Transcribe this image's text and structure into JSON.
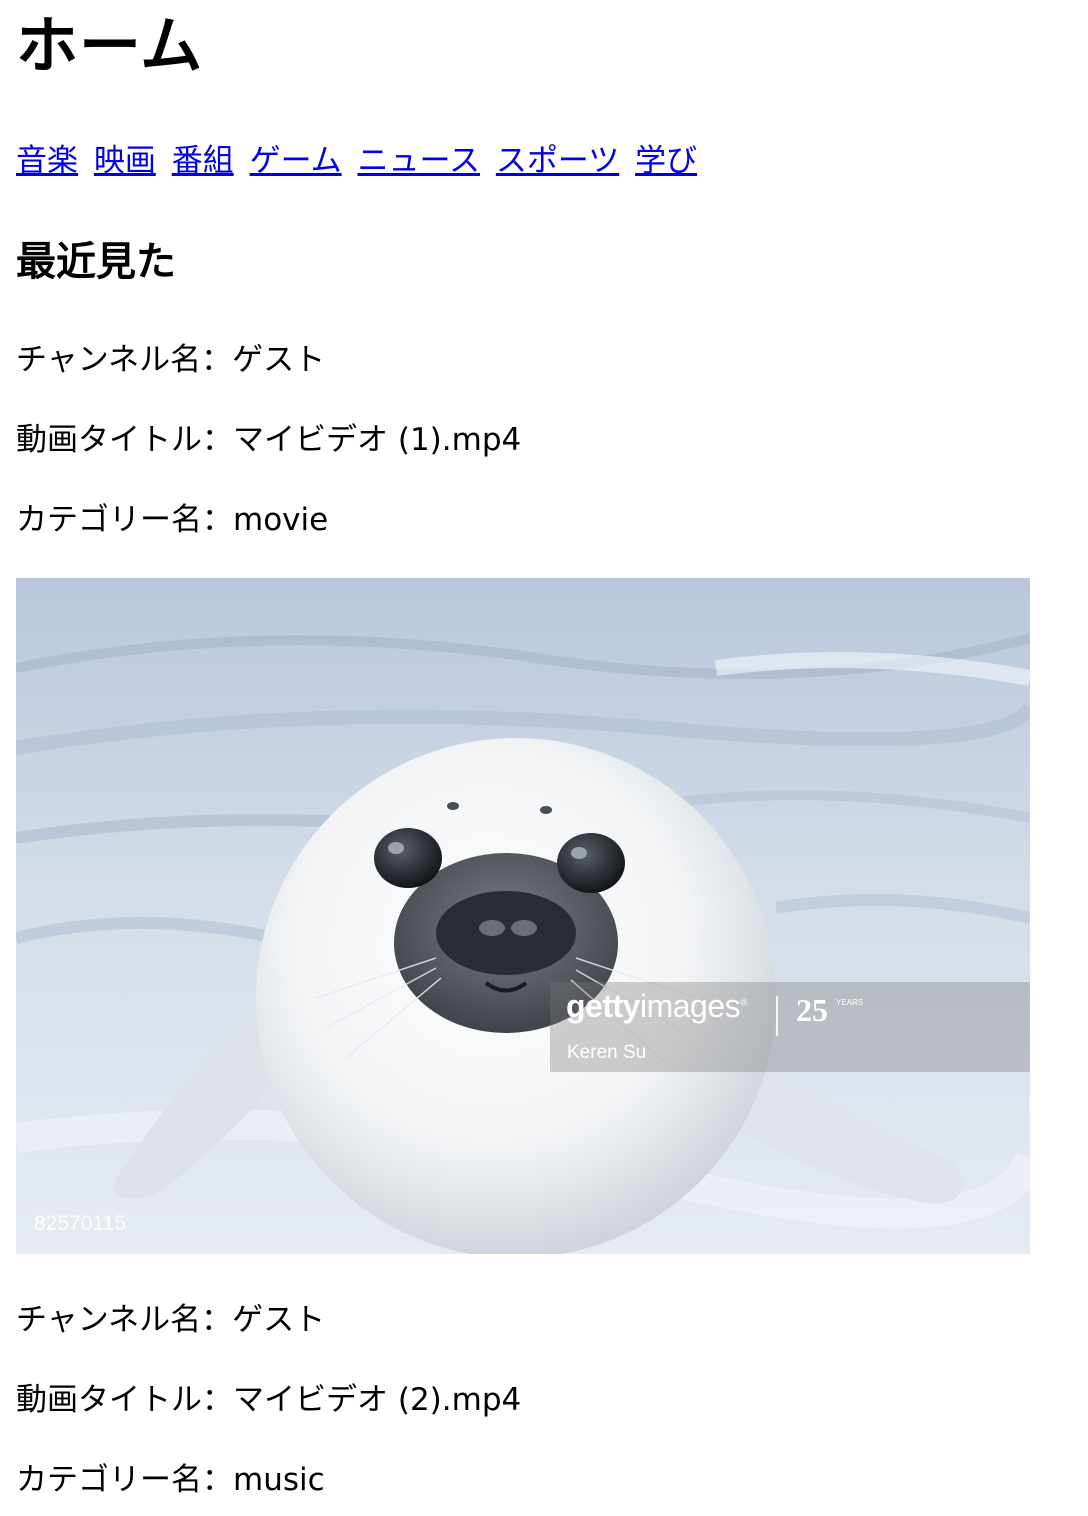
{
  "page": {
    "title": "ホーム"
  },
  "nav": {
    "links": [
      {
        "label": "音楽"
      },
      {
        "label": "映画"
      },
      {
        "label": "番組"
      },
      {
        "label": "ゲーム"
      },
      {
        "label": "ニュース"
      },
      {
        "label": "スポーツ"
      },
      {
        "label": "学び"
      }
    ]
  },
  "recent": {
    "heading": "最近見た",
    "items": [
      {
        "channel": "チャンネル名：ゲスト",
        "title": "動画タイトル：マイビデオ (1).mp4",
        "category": "カテゴリー名：movie",
        "thumbnail": {
          "watermark_brand_bold": "getty",
          "watermark_brand_light": "images",
          "watermark_brand_mark": "®",
          "watermark_anniversary": "25",
          "watermark_years": "YEARS",
          "watermark_credit": "Keren Su",
          "image_id": "82570115"
        }
      },
      {
        "channel": "チャンネル名：ゲスト",
        "title": "動画タイトル：マイビデオ (2).mp4",
        "category": "カテゴリー名：music"
      }
    ]
  },
  "colors": {
    "link": "#0000ee",
    "text": "#000000",
    "background": "#ffffff"
  }
}
